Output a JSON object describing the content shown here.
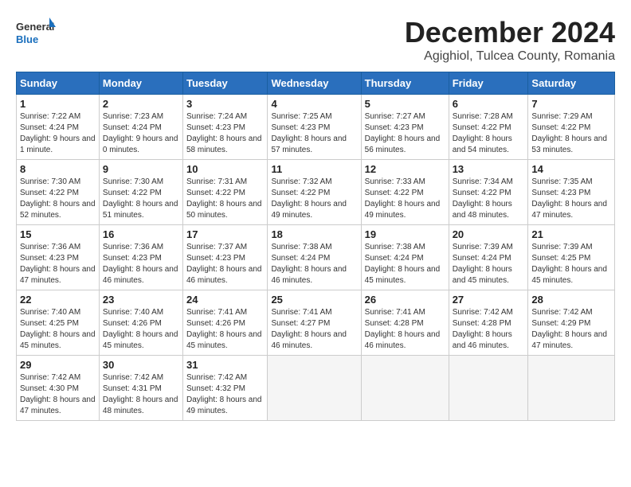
{
  "logo": {
    "general": "General",
    "blue": "Blue"
  },
  "title": "December 2024",
  "subtitle": "Agighiol, Tulcea County, Romania",
  "days_of_week": [
    "Sunday",
    "Monday",
    "Tuesday",
    "Wednesday",
    "Thursday",
    "Friday",
    "Saturday"
  ],
  "weeks": [
    [
      {
        "day": "1",
        "sunrise": "7:22 AM",
        "sunset": "4:24 PM",
        "daylight": "9 hours and 1 minute."
      },
      {
        "day": "2",
        "sunrise": "7:23 AM",
        "sunset": "4:24 PM",
        "daylight": "9 hours and 0 minutes."
      },
      {
        "day": "3",
        "sunrise": "7:24 AM",
        "sunset": "4:23 PM",
        "daylight": "8 hours and 58 minutes."
      },
      {
        "day": "4",
        "sunrise": "7:25 AM",
        "sunset": "4:23 PM",
        "daylight": "8 hours and 57 minutes."
      },
      {
        "day": "5",
        "sunrise": "7:27 AM",
        "sunset": "4:23 PM",
        "daylight": "8 hours and 56 minutes."
      },
      {
        "day": "6",
        "sunrise": "7:28 AM",
        "sunset": "4:22 PM",
        "daylight": "8 hours and 54 minutes."
      },
      {
        "day": "7",
        "sunrise": "7:29 AM",
        "sunset": "4:22 PM",
        "daylight": "8 hours and 53 minutes."
      }
    ],
    [
      {
        "day": "8",
        "sunrise": "7:30 AM",
        "sunset": "4:22 PM",
        "daylight": "8 hours and 52 minutes."
      },
      {
        "day": "9",
        "sunrise": "7:30 AM",
        "sunset": "4:22 PM",
        "daylight": "8 hours and 51 minutes."
      },
      {
        "day": "10",
        "sunrise": "7:31 AM",
        "sunset": "4:22 PM",
        "daylight": "8 hours and 50 minutes."
      },
      {
        "day": "11",
        "sunrise": "7:32 AM",
        "sunset": "4:22 PM",
        "daylight": "8 hours and 49 minutes."
      },
      {
        "day": "12",
        "sunrise": "7:33 AM",
        "sunset": "4:22 PM",
        "daylight": "8 hours and 49 minutes."
      },
      {
        "day": "13",
        "sunrise": "7:34 AM",
        "sunset": "4:22 PM",
        "daylight": "8 hours and 48 minutes."
      },
      {
        "day": "14",
        "sunrise": "7:35 AM",
        "sunset": "4:23 PM",
        "daylight": "8 hours and 47 minutes."
      }
    ],
    [
      {
        "day": "15",
        "sunrise": "7:36 AM",
        "sunset": "4:23 PM",
        "daylight": "8 hours and 47 minutes."
      },
      {
        "day": "16",
        "sunrise": "7:36 AM",
        "sunset": "4:23 PM",
        "daylight": "8 hours and 46 minutes."
      },
      {
        "day": "17",
        "sunrise": "7:37 AM",
        "sunset": "4:23 PM",
        "daylight": "8 hours and 46 minutes."
      },
      {
        "day": "18",
        "sunrise": "7:38 AM",
        "sunset": "4:24 PM",
        "daylight": "8 hours and 46 minutes."
      },
      {
        "day": "19",
        "sunrise": "7:38 AM",
        "sunset": "4:24 PM",
        "daylight": "8 hours and 45 minutes."
      },
      {
        "day": "20",
        "sunrise": "7:39 AM",
        "sunset": "4:24 PM",
        "daylight": "8 hours and 45 minutes."
      },
      {
        "day": "21",
        "sunrise": "7:39 AM",
        "sunset": "4:25 PM",
        "daylight": "8 hours and 45 minutes."
      }
    ],
    [
      {
        "day": "22",
        "sunrise": "7:40 AM",
        "sunset": "4:25 PM",
        "daylight": "8 hours and 45 minutes."
      },
      {
        "day": "23",
        "sunrise": "7:40 AM",
        "sunset": "4:26 PM",
        "daylight": "8 hours and 45 minutes."
      },
      {
        "day": "24",
        "sunrise": "7:41 AM",
        "sunset": "4:26 PM",
        "daylight": "8 hours and 45 minutes."
      },
      {
        "day": "25",
        "sunrise": "7:41 AM",
        "sunset": "4:27 PM",
        "daylight": "8 hours and 46 minutes."
      },
      {
        "day": "26",
        "sunrise": "7:41 AM",
        "sunset": "4:28 PM",
        "daylight": "8 hours and 46 minutes."
      },
      {
        "day": "27",
        "sunrise": "7:42 AM",
        "sunset": "4:28 PM",
        "daylight": "8 hours and 46 minutes."
      },
      {
        "day": "28",
        "sunrise": "7:42 AM",
        "sunset": "4:29 PM",
        "daylight": "8 hours and 47 minutes."
      }
    ],
    [
      {
        "day": "29",
        "sunrise": "7:42 AM",
        "sunset": "4:30 PM",
        "daylight": "8 hours and 47 minutes."
      },
      {
        "day": "30",
        "sunrise": "7:42 AM",
        "sunset": "4:31 PM",
        "daylight": "8 hours and 48 minutes."
      },
      {
        "day": "31",
        "sunrise": "7:42 AM",
        "sunset": "4:32 PM",
        "daylight": "8 hours and 49 minutes."
      },
      null,
      null,
      null,
      null
    ]
  ]
}
